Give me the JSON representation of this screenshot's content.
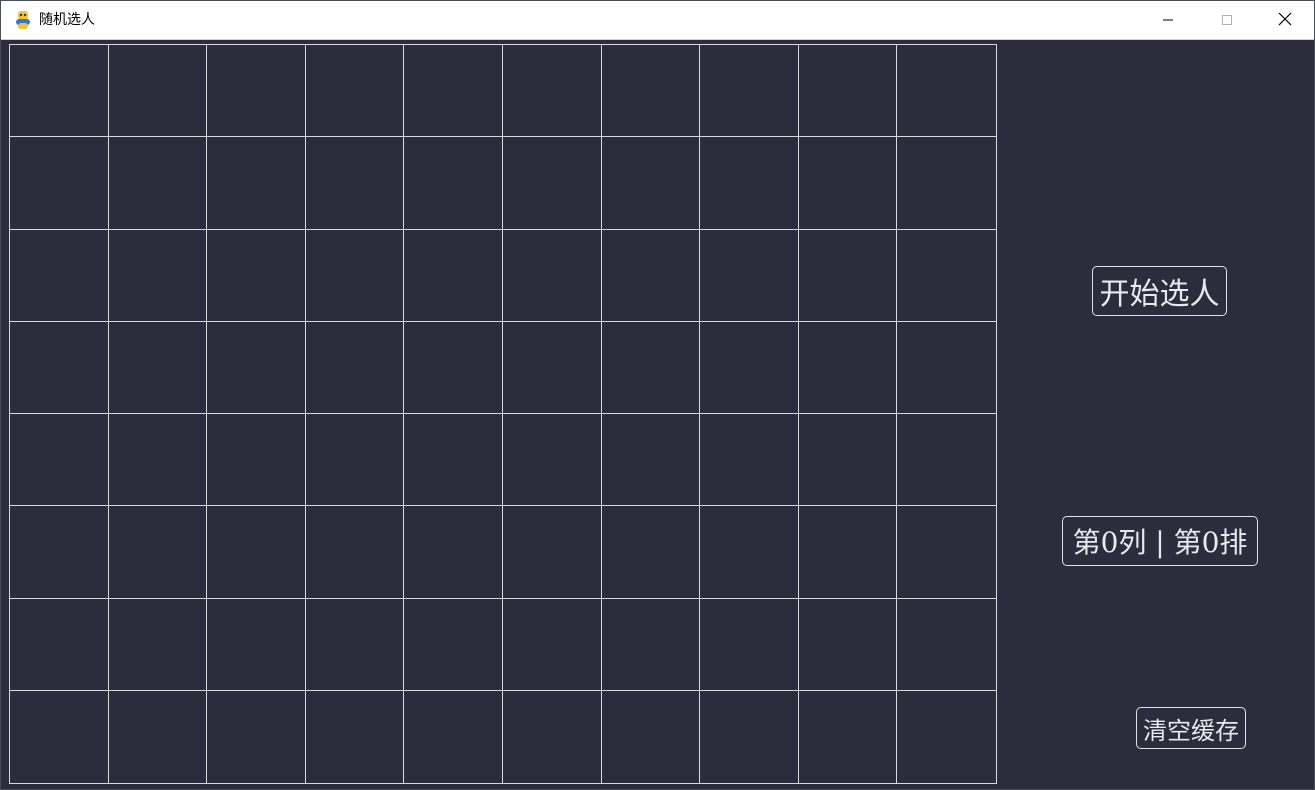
{
  "window": {
    "title": "随机选人",
    "icon": "python-snake-icon",
    "controls": {
      "minimize": "minimize-icon",
      "maximize": "maximize-icon",
      "close": "close-icon"
    }
  },
  "grid": {
    "columns": 10,
    "rows": 8,
    "line_color": "#d9d9e2",
    "background": "#2b2d3c"
  },
  "controls": {
    "start_label": "开始选人",
    "result_label": "第0列 | 第0排",
    "clear_label": "清空缓存"
  },
  "colors": {
    "background": "#2b2d3c",
    "text": "#e8e8ee",
    "title_bar": "#ffffff"
  }
}
